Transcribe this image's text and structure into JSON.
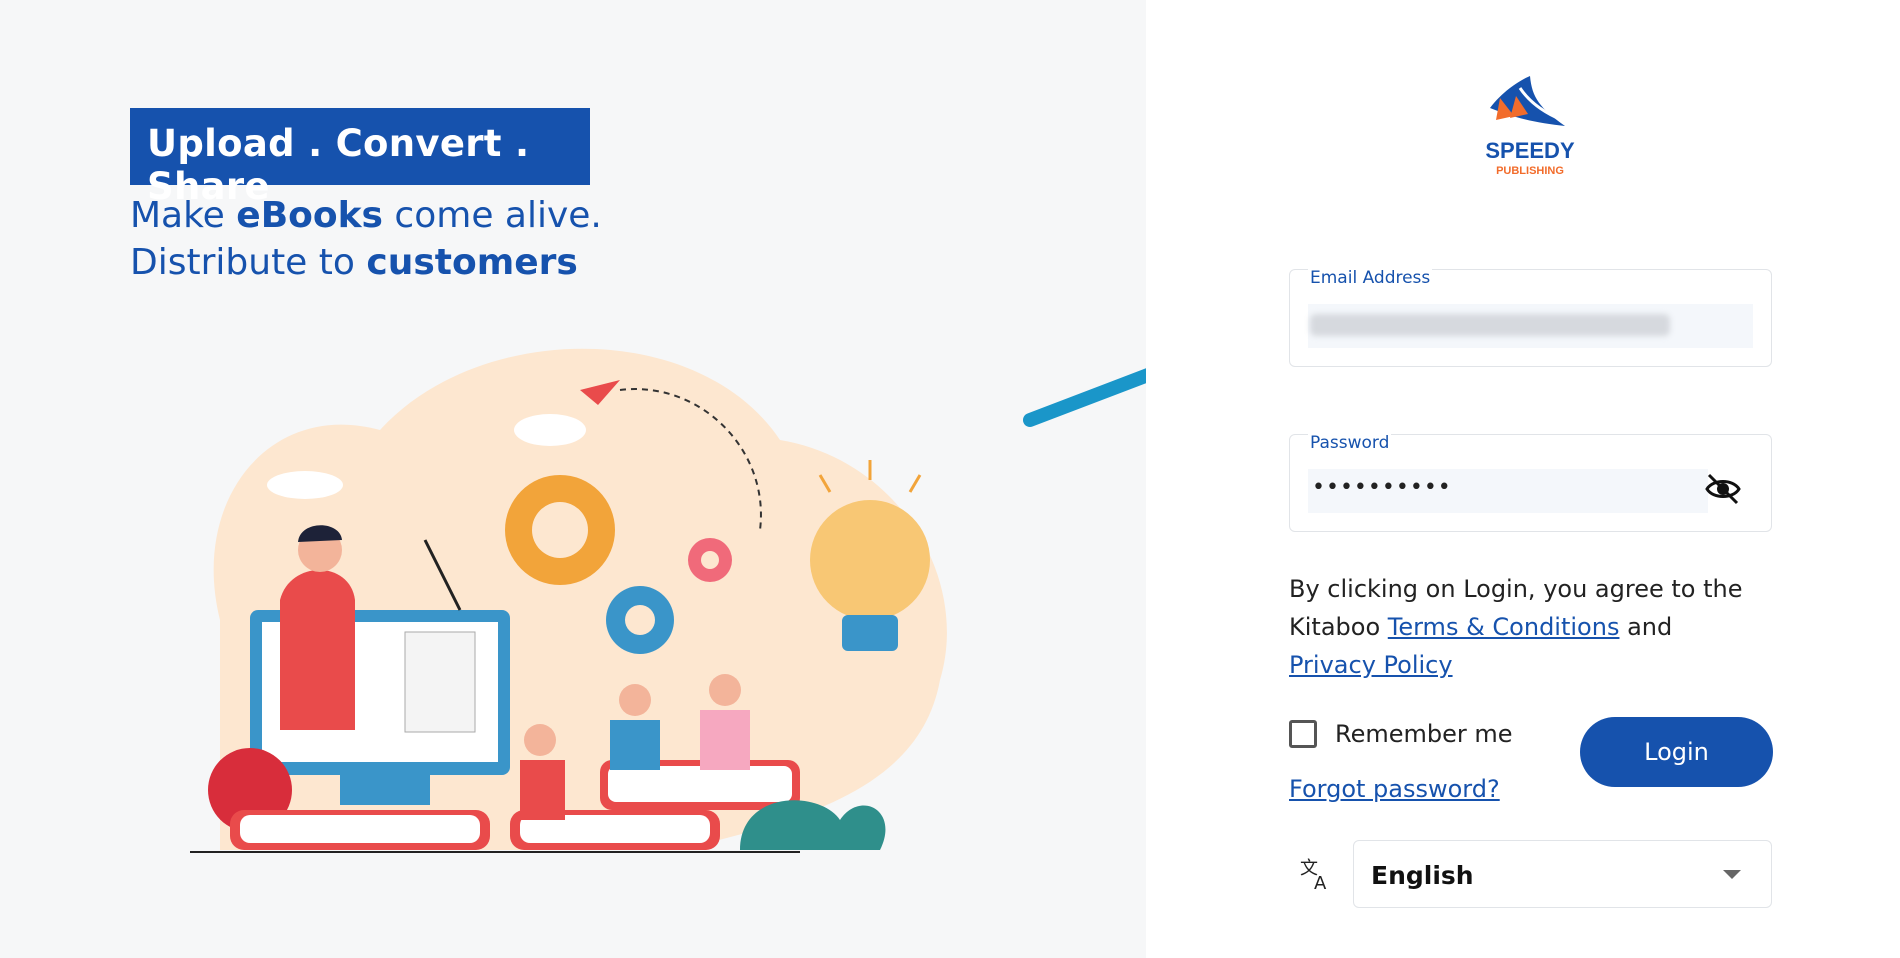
{
  "hero": {
    "tagline": "Upload . Convert . Share",
    "line1_prefix": "Make ",
    "line1_bold": "eBooks",
    "line1_suffix": " come alive.",
    "line2_prefix": "Distribute to ",
    "line2_bold": "customers"
  },
  "brand": {
    "name": "SPEEDY",
    "sub": "PUBLISHING"
  },
  "form": {
    "email_label": "Email Address",
    "password_label": "Password",
    "password_mask": "••••••••••",
    "terms_prefix": "By clicking on Login, you agree to the Kitaboo ",
    "terms_link": "Terms & Conditions",
    "terms_mid": " and",
    "privacy_link": "Privacy Policy",
    "remember_label": "Remember me",
    "forgot_link": "Forgot password?",
    "login_label": "Login",
    "language_value": "English"
  },
  "colors": {
    "primary": "#1652ad",
    "arrow": "#1a96c9"
  },
  "icons": [
    "eye-off-icon",
    "translate-icon",
    "chevron-down-icon"
  ]
}
